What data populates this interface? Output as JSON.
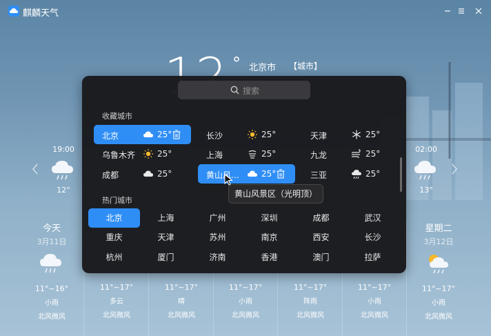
{
  "app": {
    "title": "麒麟天气"
  },
  "current": {
    "temp": "12",
    "degree": "°",
    "city": "北京市",
    "tag": "【城市】"
  },
  "hourly_left": {
    "time": "19:00",
    "temp": "12°",
    "icon": "rain-icon"
  },
  "hourly_right": {
    "time": "02:00",
    "temp": "13°",
    "icon": "rain-icon"
  },
  "daily": [
    {
      "name": "今天",
      "date": "3月11日",
      "range": "11°~16°",
      "cond": "小雨",
      "wind": "北风微风",
      "icon": "rain-icon"
    },
    {
      "name": "",
      "date": "",
      "range": "11°~17°",
      "cond": "多云",
      "wind": "北风微风",
      "icon": ""
    },
    {
      "name": "",
      "date": "",
      "range": "11°~17°",
      "cond": "晴",
      "wind": "北风微风",
      "icon": ""
    },
    {
      "name": "",
      "date": "",
      "range": "11°~17°",
      "cond": "小雨",
      "wind": "北风微风",
      "icon": ""
    },
    {
      "name": "",
      "date": "",
      "range": "11°~17°",
      "cond": "阵雨",
      "wind": "北风微风",
      "icon": ""
    },
    {
      "name": "",
      "date": "",
      "range": "11°~17°",
      "cond": "小雨",
      "wind": "北风微风",
      "icon": ""
    },
    {
      "name": "星期二",
      "date": "3月12日",
      "range": "11°~17°",
      "cond": "小雨",
      "wind": "北风微风",
      "icon": "sun-rain-icon"
    }
  ],
  "search": {
    "placeholder": "搜索"
  },
  "favorites": {
    "title": "收藏城市",
    "items": [
      {
        "name": "北京",
        "temp": "25°",
        "icon": "cloud-icon",
        "selected": true
      },
      {
        "name": "长沙",
        "temp": "25°",
        "icon": "sun-icon"
      },
      {
        "name": "天津",
        "temp": "25°",
        "icon": "snow-icon"
      },
      {
        "name": "乌鲁木齐",
        "temp": "25°",
        "icon": "sun-icon"
      },
      {
        "name": "上海",
        "temp": "25°",
        "icon": "haze-icon"
      },
      {
        "name": "九龙",
        "temp": "25°",
        "icon": "wind-icon"
      },
      {
        "name": "成都",
        "temp": "25°",
        "icon": "cloud-icon"
      },
      {
        "name": "黄山风…",
        "temp": "25°",
        "icon": "cloud-icon",
        "selected": true
      },
      {
        "name": "三亚",
        "temp": "25°",
        "icon": "rain-icon"
      }
    ]
  },
  "hot": {
    "title": "热门城市",
    "items": [
      "北京",
      "上海",
      "广州",
      "深圳",
      "成都",
      "武汉",
      "重庆",
      "天津",
      "苏州",
      "南京",
      "西安",
      "长沙",
      "杭州",
      "厦门",
      "济南",
      "香港",
      "澳门",
      "拉萨"
    ]
  },
  "tooltip": {
    "text": "黄山风景区（光明顶）"
  }
}
